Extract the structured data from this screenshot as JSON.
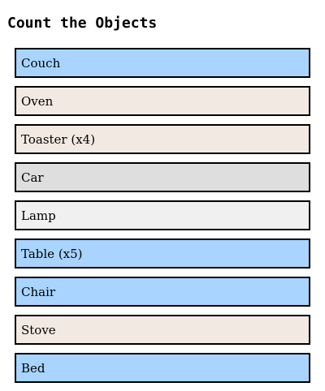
{
  "title": "Count the Objects",
  "items": [
    {
      "label": "Couch",
      "color": "#a8d4ff"
    },
    {
      "label": "Oven",
      "color": "#f2e9e3"
    },
    {
      "label": "Toaster (x4)",
      "color": "#f2e9e3"
    },
    {
      "label": "Car",
      "color": "#dedede"
    },
    {
      "label": "Lamp",
      "color": "#f0f0f0"
    },
    {
      "label": "Table (x5)",
      "color": "#a8d4ff"
    },
    {
      "label": "Chair",
      "color": "#a8d4ff"
    },
    {
      "label": "Stove",
      "color": "#f2e9e3"
    },
    {
      "label": "Bed",
      "color": "#a8d4ff"
    }
  ]
}
